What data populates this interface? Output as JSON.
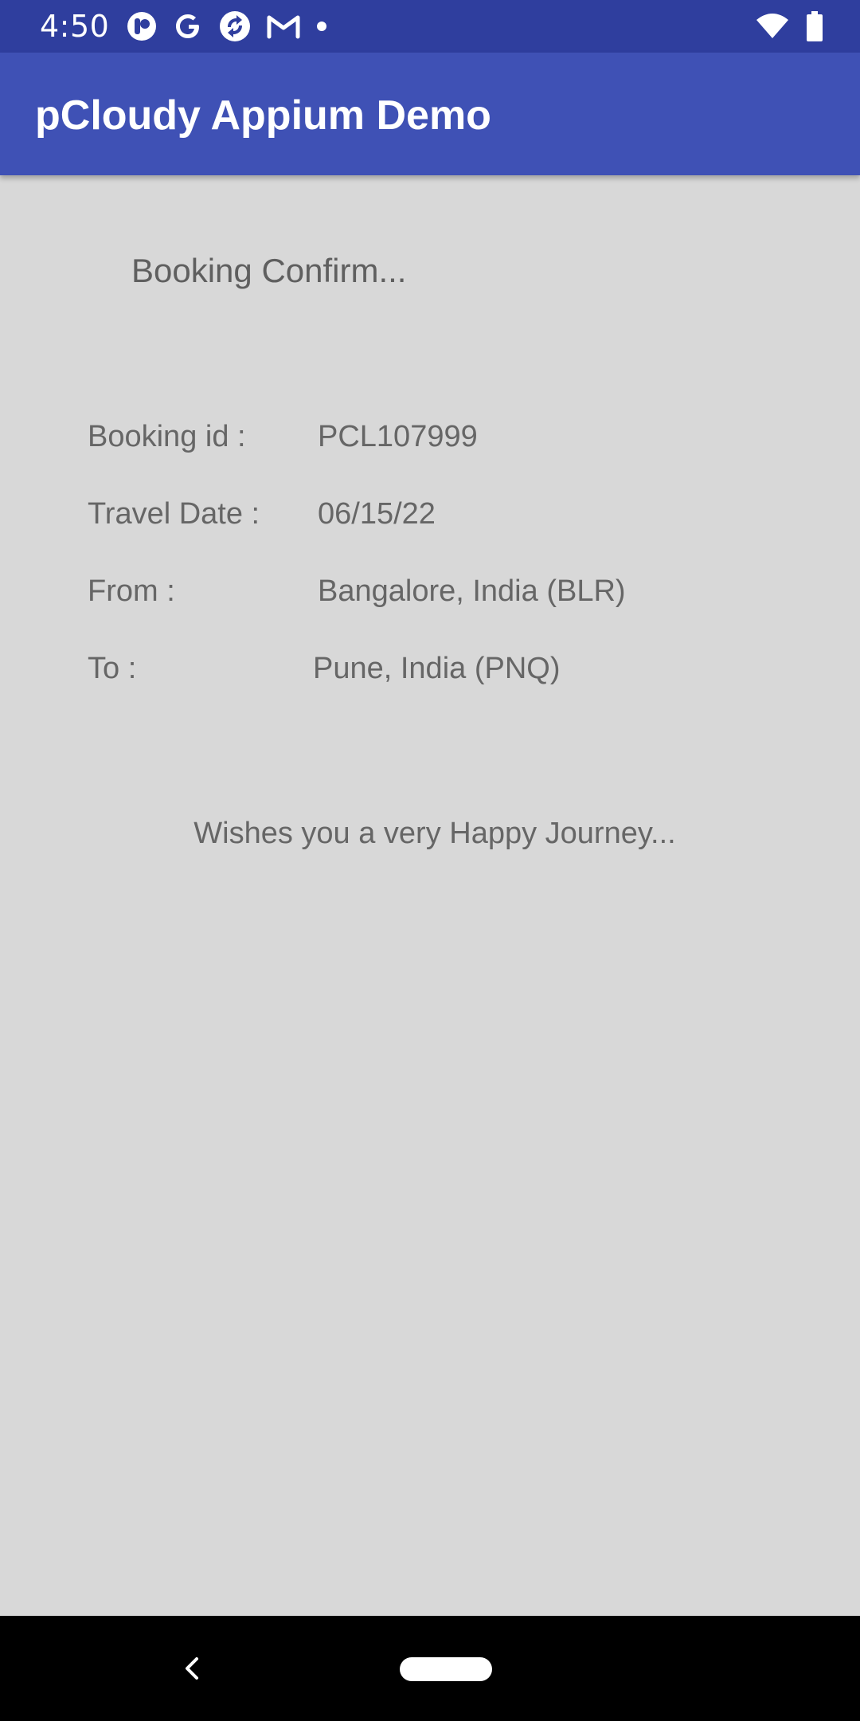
{
  "status_bar": {
    "time": "4:50",
    "notification_icons": [
      "pcloudy-icon",
      "google-icon",
      "sync-app-icon",
      "gmail-icon",
      "more-dot-icon"
    ],
    "system_icons": [
      "wifi-icon",
      "battery-icon"
    ],
    "background_color": "#2f3e9e"
  },
  "app_bar": {
    "title": "pCloudy Appium Demo",
    "background_color": "#3f51b5"
  },
  "booking": {
    "heading": "Booking Confirm...",
    "rows": [
      {
        "label": "Booking id :",
        "value": "PCL107999"
      },
      {
        "label": "Travel Date :",
        "value": "06/15/22"
      },
      {
        "label": "From :",
        "value": "Bangalore, India (BLR)"
      },
      {
        "label": "To :",
        "value": "Pune, India (PNQ)"
      }
    ],
    "wish": "Wishes you a very Happy Journey..."
  },
  "nav_bar": {
    "buttons": [
      "back-icon",
      "home-pill"
    ]
  },
  "colors": {
    "content_background": "#d8d8d8",
    "text": "#666666"
  }
}
